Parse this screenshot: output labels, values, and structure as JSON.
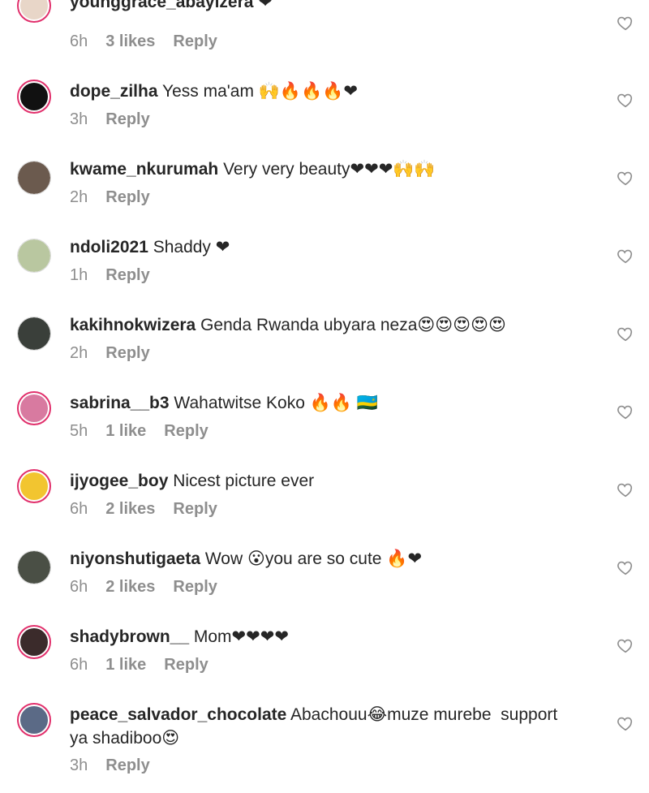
{
  "comments": [
    {
      "username": "younggrace_abayizera",
      "text": " ❤",
      "time": "6h",
      "likes": "3 likes",
      "reply": "Reply",
      "avatar_color": "#e8d6c8"
    },
    {
      "username": "dope_zilha",
      "text": " Yess ma'am 🙌🔥🔥🔥❤",
      "time": "3h",
      "likes": "",
      "reply": "Reply",
      "avatar_color": "#111111"
    },
    {
      "username": "kwame_nkurumah",
      "text": " Very very beauty❤❤❤🙌🙌",
      "time": "2h",
      "likes": "",
      "reply": "Reply",
      "avatar_color": "#6b5a4e"
    },
    {
      "username": "ndoli2021",
      "text": " Shaddy ❤",
      "time": "1h",
      "likes": "",
      "reply": "Reply",
      "avatar_color": "#b9c7a0"
    },
    {
      "username": "kakihnokwizera",
      "text": " Genda Rwanda ubyara neza😍😍😍😍😍",
      "time": "2h",
      "likes": "",
      "reply": "Reply",
      "avatar_color": "#3a3f3a"
    },
    {
      "username": "sabrina__b3",
      "text": " Wahatwitse Koko 🔥🔥 🇷🇼",
      "time": "5h",
      "likes": "1 like",
      "reply": "Reply",
      "avatar_color": "#d87aa0"
    },
    {
      "username": "ijyogee_boy",
      "text": " Nicest picture ever",
      "time": "6h",
      "likes": "2 likes",
      "reply": "Reply",
      "avatar_color": "#f2c530"
    },
    {
      "username": "niyonshutigaeta",
      "text": " Wow 😮you are so cute 🔥❤",
      "time": "6h",
      "likes": "2 likes",
      "reply": "Reply",
      "avatar_color": "#4a4f45"
    },
    {
      "username": "shadybrown__",
      "text": " Mom❤❤❤❤",
      "time": "6h",
      "likes": "1 like",
      "reply": "Reply",
      "avatar_color": "#3b2b2b"
    },
    {
      "username": "peace_salvador_chocolate",
      "text": " Abachouu😂muze murebe  support ya shadiboo😍",
      "time": "3h",
      "likes": "",
      "reply": "Reply",
      "avatar_color": "#5b6a86"
    }
  ],
  "colors": {
    "ring": "#e1306c",
    "meta": "#8e8e8e",
    "text": "#262626"
  },
  "icons": {
    "like": "heart-outline-icon"
  }
}
